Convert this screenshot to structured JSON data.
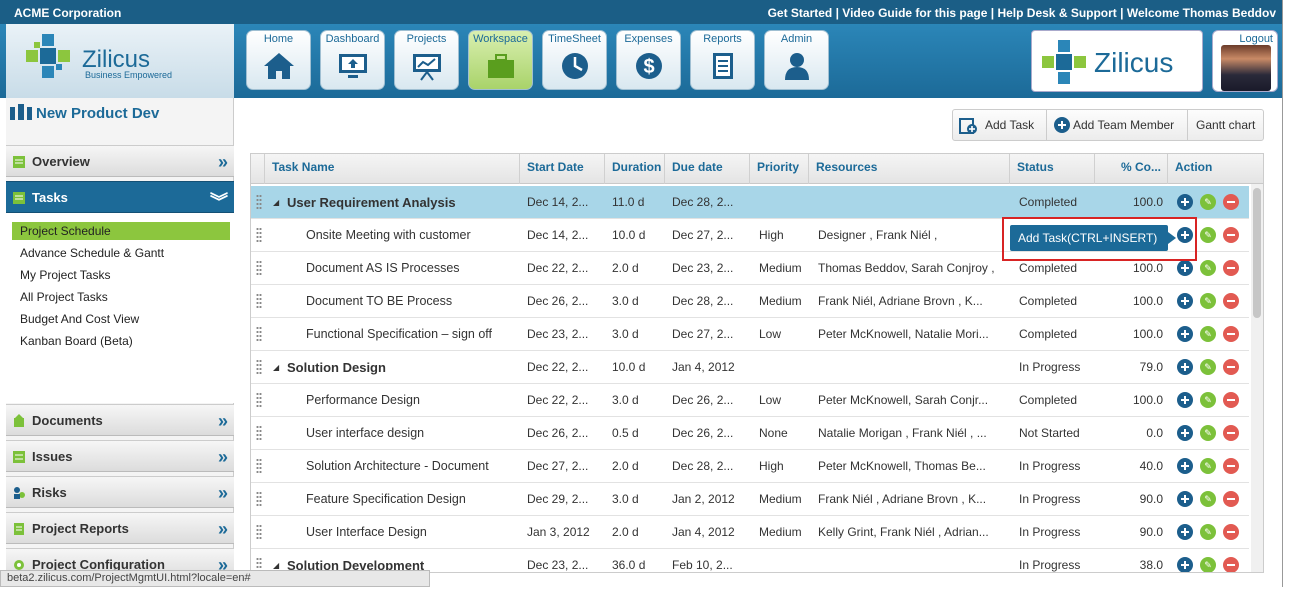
{
  "topbar": {
    "company": "ACME Corporation",
    "links": [
      "Get Started",
      "Video Guide for this page",
      "Help Desk & Support",
      "Welcome Thomas Beddov"
    ]
  },
  "brand": {
    "name": "Zilicus",
    "tagline": "Business Empowered",
    "accent": "#1c6a98",
    "green": "#8cc63e"
  },
  "nav": [
    {
      "label": "Home",
      "icon": "home-icon"
    },
    {
      "label": "Dashboard",
      "icon": "monitor-icon"
    },
    {
      "label": "Projects",
      "icon": "presentation-icon"
    },
    {
      "label": "Workspace",
      "icon": "briefcase-icon",
      "active": true
    },
    {
      "label": "TimeSheet",
      "icon": "clock-icon"
    },
    {
      "label": "Expenses",
      "icon": "dollar-icon"
    },
    {
      "label": "Reports",
      "icon": "document-icon"
    },
    {
      "label": "Admin",
      "icon": "user-icon"
    }
  ],
  "user": {
    "logout": "Logout"
  },
  "sidebar": {
    "project": "New Product Dev",
    "sections": [
      {
        "label": "Overview"
      },
      {
        "label": "Tasks",
        "open": true
      },
      {
        "label": "Documents"
      },
      {
        "label": "Issues"
      },
      {
        "label": "Risks"
      },
      {
        "label": "Project Reports"
      },
      {
        "label": "Project Configuration"
      }
    ],
    "task_items": [
      {
        "label": "Project Schedule",
        "active": true
      },
      {
        "label": "Advance Schedule & Gantt"
      },
      {
        "label": "My Project Tasks"
      },
      {
        "label": "All Project Tasks"
      },
      {
        "label": "Budget And Cost View"
      },
      {
        "label": "Kanban Board (Beta)"
      }
    ]
  },
  "toolbar": {
    "add_task": "Add Task",
    "add_member": "Add Team Member",
    "gantt": "Gantt chart"
  },
  "grid": {
    "headers": [
      "Task Name",
      "Start Date",
      "Duration",
      "Due date",
      "Priority",
      "Resources",
      "Status",
      "% Co...",
      "Action"
    ],
    "rows": [
      {
        "group": true,
        "selected": true,
        "name": "User Requirement Analysis",
        "start": "Dec 14, 2...",
        "duration": "11.0 d",
        "due": "Dec 28, 2...",
        "priority": "",
        "resources": "",
        "status": "Completed",
        "pct": "100.0"
      },
      {
        "name": "Onsite Meeting with customer",
        "start": "Dec 14, 2...",
        "duration": "10.0 d",
        "due": "Dec 27, 2...",
        "priority": "High",
        "resources": "Designer , Frank Niél ,",
        "status": "",
        "pct": ""
      },
      {
        "name": "Document AS IS Processes",
        "start": "Dec 22, 2...",
        "duration": "2.0 d",
        "due": "Dec 23, 2...",
        "priority": "Medium",
        "resources": "Thomas Beddov, Sarah Conjroy ,",
        "status": "Completed",
        "pct": "100.0"
      },
      {
        "name": "Document TO BE Process",
        "start": "Dec 26, 2...",
        "duration": "3.0 d",
        "due": "Dec 28, 2...",
        "priority": "Medium",
        "resources": "Frank Niél, Adriane Brovn , K...",
        "status": "Completed",
        "pct": "100.0"
      },
      {
        "name": "Functional Specification – sign off",
        "start": "Dec 23, 2...",
        "duration": "3.0 d",
        "due": "Dec 27, 2...",
        "priority": "Low",
        "resources": "Peter McKnowell, Natalie Mori...",
        "status": "Completed",
        "pct": "100.0"
      },
      {
        "group": true,
        "name": "Solution Design",
        "start": "Dec 22, 2...",
        "duration": "10.0 d",
        "due": "Jan 4, 2012",
        "priority": "",
        "resources": "",
        "status": "In Progress",
        "pct": "79.0"
      },
      {
        "name": "Performance Design",
        "start": "Dec 22, 2...",
        "duration": "3.0 d",
        "due": "Dec 26, 2...",
        "priority": "Low",
        "resources": "Peter McKnowell, Sarah Conjr...",
        "status": "Completed",
        "pct": "100.0"
      },
      {
        "name": "User interface design",
        "start": "Dec 26, 2...",
        "duration": "0.5 d",
        "due": "Dec 26, 2...",
        "priority": "None",
        "resources": "Natalie Morigan , Frank Niél , ...",
        "status": "Not Started",
        "pct": "0.0"
      },
      {
        "name": "Solution Architecture - Document",
        "start": "Dec 27, 2...",
        "duration": "2.0 d",
        "due": "Dec 28, 2...",
        "priority": "High",
        "resources": "Peter McKnowell, Thomas Be...",
        "status": "In Progress",
        "pct": "40.0"
      },
      {
        "name": "Feature Specification Design",
        "start": "Dec 29, 2...",
        "duration": "3.0 d",
        "due": "Jan 2, 2012",
        "priority": "Medium",
        "resources": "Frank Niél , Adriane Brovn , K...",
        "status": "In Progress",
        "pct": "90.0"
      },
      {
        "name": "User Interface Design",
        "start": "Jan 3, 2012",
        "duration": "2.0 d",
        "due": "Jan 4, 2012",
        "priority": "Medium",
        "resources": "Kelly Grint, Frank Niél , Adrian...",
        "status": "In Progress",
        "pct": "90.0"
      },
      {
        "group": true,
        "name": "Solution Development",
        "start": "Dec 23, 2...",
        "duration": "36.0 d",
        "due": "Feb 10, 2...",
        "priority": "",
        "resources": "",
        "status": "In Progress",
        "pct": "38.0"
      }
    ]
  },
  "tooltip": {
    "text": "Add Task(CTRL+INSERT)"
  },
  "statusbar": {
    "url": "beta2.zilicus.com/ProjectMgmtUI.html?locale=en#"
  }
}
